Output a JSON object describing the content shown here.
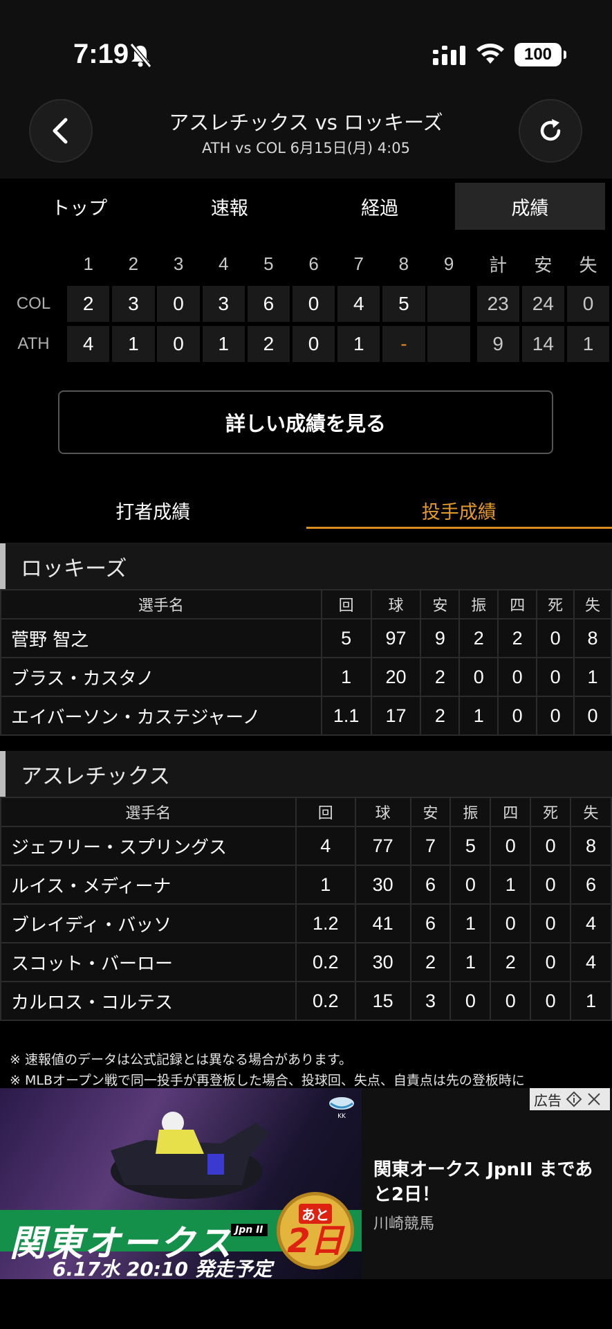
{
  "status": {
    "time": "7:19",
    "battery": "100"
  },
  "header": {
    "title": "アスレチックス vs ロッキーズ",
    "subtitle": "ATH vs COL 6月15日(月) 4:05"
  },
  "tabs": [
    {
      "label": "トップ"
    },
    {
      "label": "速報"
    },
    {
      "label": "経過"
    },
    {
      "label": "成績"
    }
  ],
  "linescore": {
    "headers": [
      "1",
      "2",
      "3",
      "4",
      "5",
      "6",
      "7",
      "8",
      "9",
      "計",
      "安",
      "失"
    ],
    "teams": [
      {
        "name": "COL",
        "innings": [
          "2",
          "3",
          "0",
          "3",
          "6",
          "0",
          "4",
          "5",
          ""
        ],
        "totals": [
          "23",
          "24",
          "0"
        ]
      },
      {
        "name": "ATH",
        "innings": [
          "4",
          "1",
          "0",
          "1",
          "2",
          "0",
          "1",
          "-",
          ""
        ],
        "totals": [
          "9",
          "14",
          "1"
        ]
      }
    ]
  },
  "detail_button": "詳しい成績を見る",
  "subtabs": [
    {
      "label": "打者成績"
    },
    {
      "label": "投手成績"
    }
  ],
  "pitching": {
    "columns": [
      "選手名",
      "回",
      "球",
      "安",
      "振",
      "四",
      "死",
      "失"
    ],
    "teams": [
      {
        "name": "ロッキーズ",
        "rows": [
          [
            "菅野 智之",
            "5",
            "97",
            "9",
            "2",
            "2",
            "0",
            "8"
          ],
          [
            "ブラス・カスタノ",
            "1",
            "20",
            "2",
            "0",
            "0",
            "0",
            "1"
          ],
          [
            "エイバーソン・カステジャーノ",
            "1.1",
            "17",
            "2",
            "1",
            "0",
            "0",
            "0"
          ]
        ]
      },
      {
        "name": "アスレチックス",
        "rows": [
          [
            "ジェフリー・スプリングス",
            "4",
            "77",
            "7",
            "5",
            "0",
            "0",
            "8"
          ],
          [
            "ルイス・メディーナ",
            "1",
            "30",
            "6",
            "0",
            "1",
            "0",
            "6"
          ],
          [
            "ブレイディ・バッソ",
            "1.2",
            "41",
            "6",
            "1",
            "0",
            "0",
            "4"
          ],
          [
            "スコット・バーロー",
            "0.2",
            "30",
            "2",
            "1",
            "2",
            "0",
            "4"
          ],
          [
            "カルロス・コルテス",
            "0.2",
            "15",
            "3",
            "0",
            "0",
            "0",
            "1"
          ]
        ]
      }
    ]
  },
  "notes": [
    "※ 速報値のデータは公式記録とは異なる場合があります。",
    "※ MLBオープン戦で同一投手が再登板した場合、投球回、失点、自責点は先の登板時に"
  ],
  "ad": {
    "label": "広告",
    "image_title": "関東オークス",
    "image_grade": "Jpn II",
    "image_date": "6.17水 20:10 発走予定",
    "badge_top": "あと",
    "badge_num": "2日",
    "headline": "関東オークス JpnII まであと2日！",
    "source": "川崎競馬"
  }
}
